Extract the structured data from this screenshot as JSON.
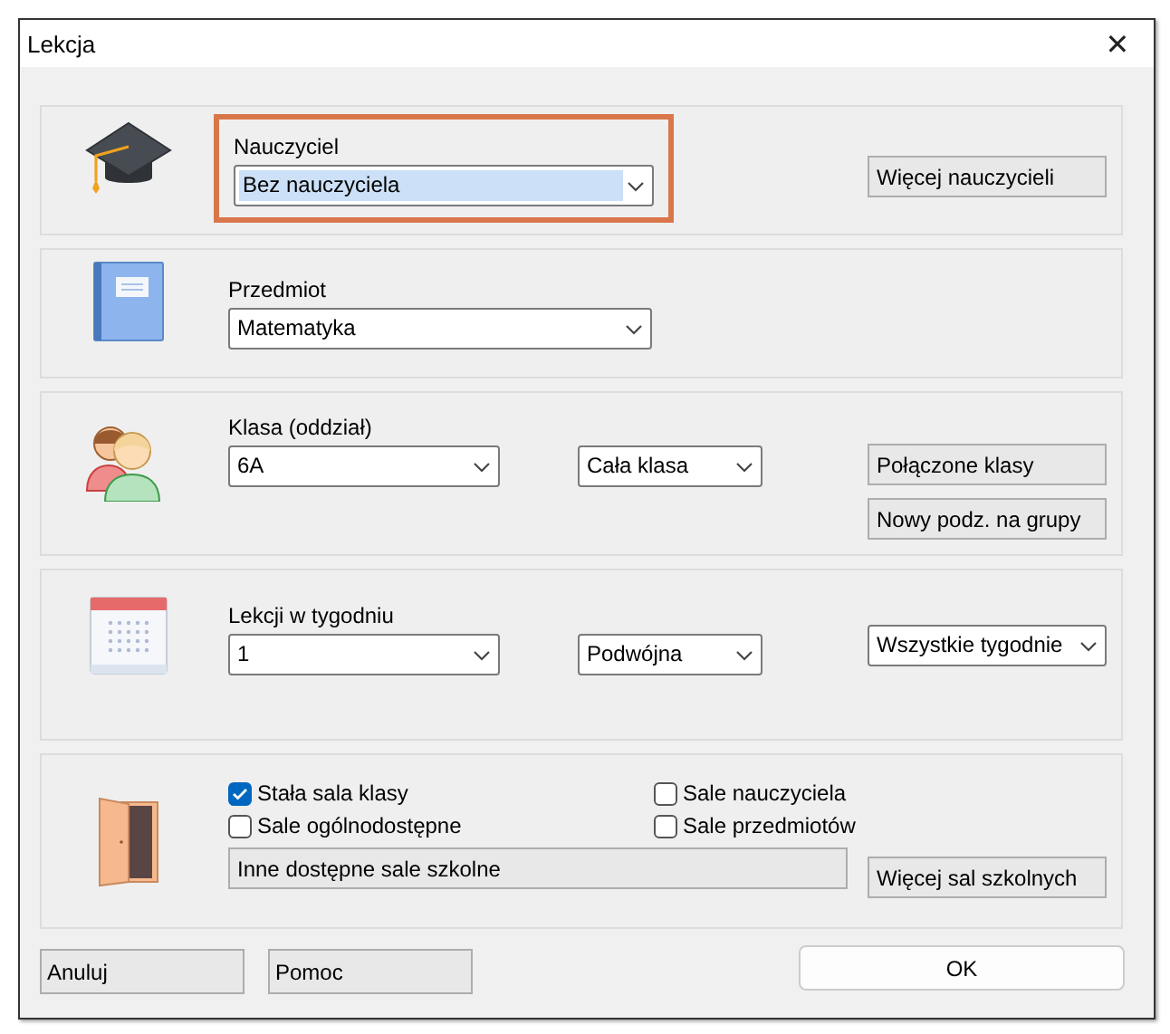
{
  "window": {
    "title": "Lekcja",
    "close": "✕"
  },
  "sections": [
    {
      "kind": "teacher",
      "highlighted": true,
      "label": "Nauczyciel",
      "dropdowns": [
        {
          "value": "Bez nauczyciela",
          "selected": true
        }
      ],
      "side": [
        {
          "kind": "button",
          "label": "Więcej nauczycieli"
        }
      ]
    },
    {
      "kind": "subject",
      "highlighted": false,
      "label": "Przedmiot",
      "dropdowns": [
        {
          "value": "Matematyka",
          "selected": false
        }
      ]
    },
    {
      "kind": "class",
      "highlighted": false,
      "label": "Klasa (oddział)",
      "dropdowns": [
        {
          "value": "6A",
          "selected": false
        },
        {
          "value": "Cała klasa",
          "selected": false
        }
      ],
      "side": [
        {
          "kind": "button",
          "label": "Połączone klasy"
        },
        {
          "kind": "button",
          "label": "Nowy podz. na grupy"
        }
      ]
    },
    {
      "kind": "lessons",
      "highlighted": false,
      "label": "Lekcji w tygodniu",
      "dropdowns": [
        {
          "value": "1",
          "selected": false
        },
        {
          "value": "Podwójna",
          "selected": false
        }
      ],
      "side": [
        {
          "kind": "dropdown",
          "value": "Wszystkie tygodnie"
        }
      ]
    },
    {
      "kind": "rooms",
      "checkboxes": [
        {
          "label": "Stała sala klasy",
          "checked": true
        },
        {
          "label": "Sale nauczyciela",
          "checked": false
        },
        {
          "label": "Sale ogólnodostępne",
          "checked": false
        },
        {
          "label": "Sale przedmiotów",
          "checked": false
        }
      ],
      "field": "Inne dostępne sale szkolne",
      "side": [
        {
          "kind": "button",
          "label": "Więcej sal szkolnych"
        }
      ]
    }
  ],
  "footer": {
    "buttons": [
      "Anuluj",
      "Pomoc"
    ],
    "ok": "OK"
  }
}
